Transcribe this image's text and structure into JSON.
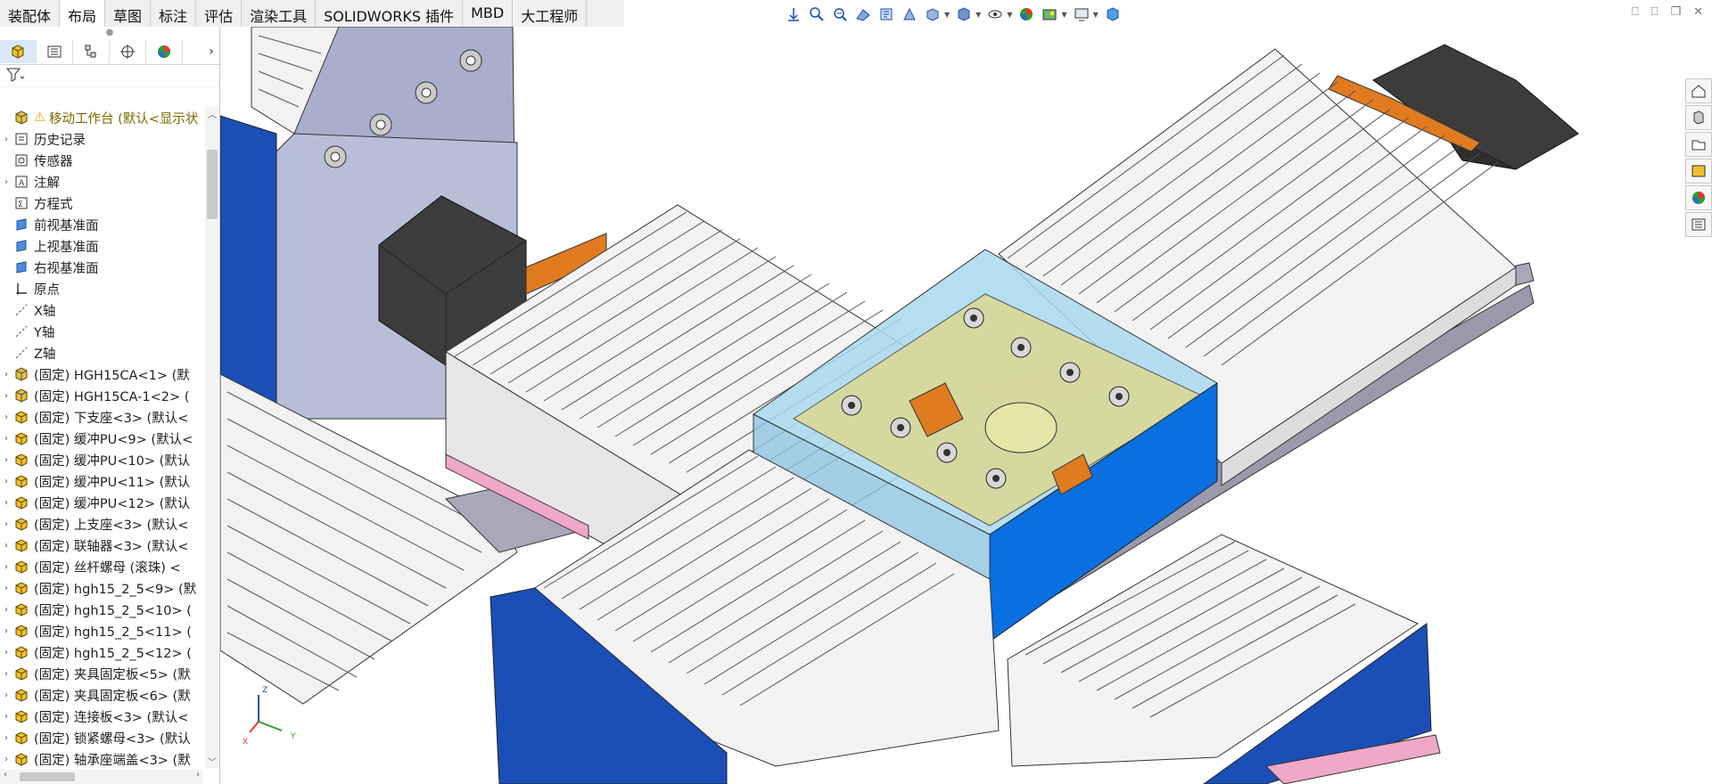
{
  "tabs": [
    "装配体",
    "布局",
    "草图",
    "标注",
    "评估",
    "渲染工具",
    "SOLIDWORKS 插件",
    "MBD",
    "大工程师"
  ],
  "active_tab": "布局",
  "tree": {
    "root": "移动工作台 (默认<显示状",
    "items": [
      {
        "label": "历史记录",
        "icon": "history-icon",
        "expand": true
      },
      {
        "label": "传感器",
        "icon": "sensor-icon",
        "expand": false
      },
      {
        "label": "注解",
        "icon": "annotation-icon",
        "expand": true
      },
      {
        "label": "方程式",
        "icon": "equation-icon",
        "expand": false
      },
      {
        "label": "前视基准面",
        "icon": "plane-icon",
        "expand": false
      },
      {
        "label": "上视基准面",
        "icon": "plane-icon",
        "expand": false
      },
      {
        "label": "右视基准面",
        "icon": "plane-icon",
        "expand": false
      },
      {
        "label": "原点",
        "icon": "origin-icon",
        "expand": false
      },
      {
        "label": "X轴",
        "icon": "axis-icon",
        "expand": false
      },
      {
        "label": "Y轴",
        "icon": "axis-icon",
        "expand": false
      },
      {
        "label": "Z轴",
        "icon": "axis-icon",
        "expand": false
      },
      {
        "label": "(固定) HGH15CA<1> (默",
        "icon": "subassembly-icon",
        "expand": true
      },
      {
        "label": "(固定) HGH15CA-1<2> (",
        "icon": "subassembly-icon",
        "expand": true
      },
      {
        "label": "(固定) 下支座<3> (默认<",
        "icon": "part-icon",
        "expand": true
      },
      {
        "label": "(固定) 缓冲PU<9> (默认<",
        "icon": "part-icon",
        "expand": true
      },
      {
        "label": "(固定) 缓冲PU<10> (默认",
        "icon": "part-icon",
        "expand": true
      },
      {
        "label": "(固定) 缓冲PU<11> (默认",
        "icon": "part-icon",
        "expand": true
      },
      {
        "label": "(固定) 缓冲PU<12> (默认",
        "icon": "part-icon",
        "expand": true
      },
      {
        "label": "(固定) 上支座<3> (默认<",
        "icon": "part-icon",
        "expand": true
      },
      {
        "label": "(固定) 联轴器<3> (默认<",
        "icon": "part-icon",
        "expand": true
      },
      {
        "label": "(固定) 丝杆螺母 (滚珠) <",
        "icon": "part-icon",
        "expand": true
      },
      {
        "label": "(固定) hgh15_2_5<9> (默",
        "icon": "part-icon",
        "expand": true
      },
      {
        "label": "(固定) hgh15_2_5<10> (",
        "icon": "part-icon",
        "expand": true
      },
      {
        "label": "(固定) hgh15_2_5<11> (",
        "icon": "part-icon",
        "expand": true
      },
      {
        "label": "(固定) hgh15_2_5<12> (",
        "icon": "part-icon",
        "expand": true
      },
      {
        "label": "(固定) 夹具固定板<5> (默",
        "icon": "part-icon",
        "expand": true
      },
      {
        "label": "(固定) 夹具固定板<6> (默",
        "icon": "part-icon",
        "expand": true
      },
      {
        "label": "(固定) 连接板<3> (默认<",
        "icon": "part-icon",
        "expand": true
      },
      {
        "label": "(固定) 锁紧螺母<3> (默认",
        "icon": "part-icon",
        "expand": true
      },
      {
        "label": "(固定) 轴承座端盖<3> (默",
        "icon": "part-icon",
        "expand": true
      }
    ]
  },
  "triad": {
    "x": "X",
    "y": "Y",
    "z": "Z"
  },
  "colors": {
    "plate_blue": "#1a4fb8",
    "panel_blue": "#0a6fe0",
    "bellows": "#f0f0f0",
    "motor": "#3c3c3c",
    "orange": "#e07b20",
    "pink": "#f0a8c8",
    "yellow_transp": "#d8d89a"
  }
}
